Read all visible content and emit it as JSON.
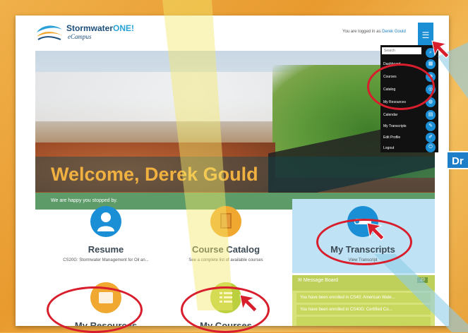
{
  "brand": {
    "name_part1": "Stormwater",
    "name_part2": "ONE",
    "name_part3": "!",
    "sub": "eCampus"
  },
  "header": {
    "logged_prefix": "You are logged in as ",
    "user": "Derek Gould"
  },
  "hero": {
    "title": "Welcome, Derek Gould",
    "subtitle": "We are happy you stopped by."
  },
  "tiles": [
    {
      "title": "Resume",
      "desc": "CS20G: Stormwater Management for Oil an..."
    },
    {
      "title": "Course Catalog",
      "desc": "See a complete list of available courses"
    },
    {
      "title": "My Transcripts",
      "desc": "View Transcript"
    },
    {
      "title": "My Resources",
      "desc": ""
    },
    {
      "title": "My Courses",
      "desc": ""
    }
  ],
  "dropdown": {
    "search_placeholder": "Search",
    "items": [
      "Dashboard",
      "Courses",
      "Catalog",
      "My Resources",
      "Calendar",
      "My Transcripts",
      "Edit Profile",
      "Logout"
    ]
  },
  "message_board": {
    "title": "Message Board",
    "count": "20",
    "messages": [
      "You have been enrolled in CS40: American Wate...",
      "You have been enrolled in CS40G: Certified Co...",
      ""
    ]
  },
  "callout": {
    "label": "Dr"
  },
  "colors": {
    "accent": "#1a8fd6",
    "highlight": "#d81e2c",
    "gold": "#f0b140",
    "panel_blue": "#bfe3f5"
  }
}
